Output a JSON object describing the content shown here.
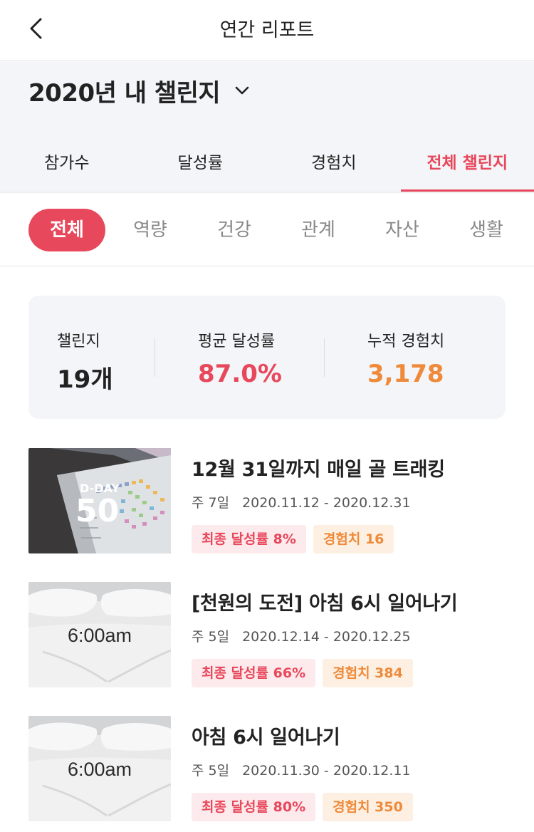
{
  "topbar": {
    "title": "연간 리포트"
  },
  "header": {
    "year_title": "2020년 내 챌린지",
    "tabs": [
      {
        "label": "참가수"
      },
      {
        "label": "달성률"
      },
      {
        "label": "경험치"
      },
      {
        "label": "전체 챌린지",
        "active": true
      }
    ]
  },
  "categories": [
    {
      "label": "전체",
      "active": true
    },
    {
      "label": "역량"
    },
    {
      "label": "건강"
    },
    {
      "label": "관계"
    },
    {
      "label": "자산"
    },
    {
      "label": "생활"
    }
  ],
  "summary": {
    "challenges": {
      "label": "챌린지",
      "value": "19개"
    },
    "avg_rate": {
      "label": "평균 달성률",
      "value": "87.0%"
    },
    "total_exp": {
      "label": "누적 경험치",
      "value": "3,178"
    }
  },
  "colors": {
    "accent": "#e8485c",
    "rate_value": "#e8485c",
    "exp_value": "#ef8a3a",
    "header_bg": "#f4f5f8"
  },
  "challenges": [
    {
      "title": "12월 31일까지 매일 골 트래킹",
      "frequency": "주 7일",
      "dates": "2020.11.12 - 2020.12.31",
      "rate_tag": "최종 달성률 8%",
      "exp_tag": "경험치 16",
      "thumb": {
        "line1": "D-DAY",
        "line2": "50"
      }
    },
    {
      "title": "[천원의 도전] 아침 6시 일어나기",
      "frequency": "주 5일",
      "dates": "2020.12.14 - 2020.12.25",
      "rate_tag": "최종 달성률 66%",
      "exp_tag": "경험치 384",
      "thumb": {
        "text": "6:00am"
      }
    },
    {
      "title": "아침 6시 일어나기",
      "frequency": "주 5일",
      "dates": "2020.11.30 - 2020.12.11",
      "rate_tag": "최종 달성률 80%",
      "exp_tag": "경험치 350",
      "thumb": {
        "text": "6:00am"
      }
    }
  ]
}
